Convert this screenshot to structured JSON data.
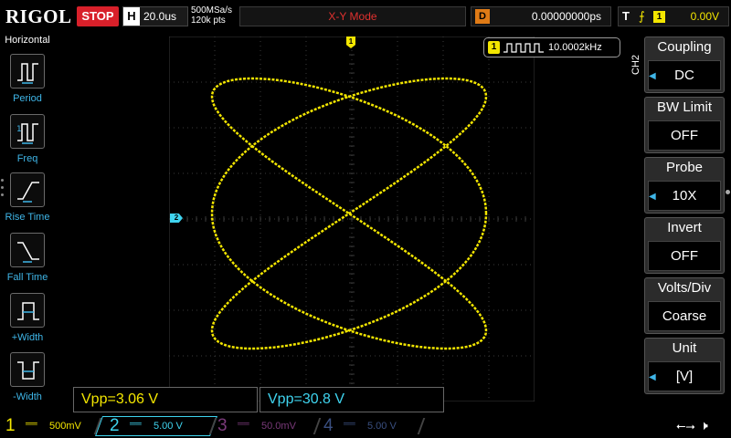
{
  "topbar": {
    "logo": "RIGOL",
    "run_state": "STOP",
    "horizontal_letter": "H",
    "timebase": "20.0us",
    "sample_rate": "500MSa/s",
    "memory_depth": "120k pts",
    "mode": "X-Y Mode",
    "delay_letter": "D",
    "delay_value": "0.00000000ps",
    "trigger_letter": "T",
    "trigger_edge": "⨍",
    "trigger_source": "1",
    "trigger_level": "0.00V"
  },
  "sidebar": {
    "title": "Horizontal",
    "items": [
      {
        "label": "Period"
      },
      {
        "label": "Freq"
      },
      {
        "label": "Rise Time"
      },
      {
        "label": "Fall Time"
      },
      {
        "label": "+Width"
      },
      {
        "label": "-Width"
      }
    ]
  },
  "markers": {
    "ch1": "1",
    "ch2": "2"
  },
  "freq_counter": {
    "channel": "1",
    "value": "10.0002kHz"
  },
  "right_menu": {
    "channel_tag": "CH2",
    "items": [
      {
        "title": "Coupling",
        "value": "DC"
      },
      {
        "title": "BW Limit",
        "value": "OFF"
      },
      {
        "title": "Probe",
        "value": "10X"
      },
      {
        "title": "Invert",
        "value": "OFF"
      },
      {
        "title": "Volts/Div",
        "value": "Coarse"
      },
      {
        "title": "Unit",
        "value": "[V]"
      }
    ]
  },
  "measurements": [
    {
      "text": "Vpp=3.06 V"
    },
    {
      "text": "Vpp=30.8 V"
    }
  ],
  "channels": [
    {
      "num": "1",
      "coupling": "══",
      "scale": "500mV"
    },
    {
      "num": "2",
      "coupling": "══",
      "scale": "5.00 V"
    },
    {
      "num": "3",
      "coupling": "══",
      "scale": "50.0mV"
    },
    {
      "num": "4",
      "coupling": "══",
      "scale": "5.00 V"
    }
  ],
  "colors": {
    "ch1": "#f3e600",
    "ch2": "#3fd4ef",
    "ch3": "#7a3a7a",
    "ch4": "#3a4f80",
    "stop": "#d8202a",
    "accent": "#3fb6e8"
  },
  "icons": {
    "usb": "usb-icon",
    "speaker": "speaker-muted-icon"
  }
}
